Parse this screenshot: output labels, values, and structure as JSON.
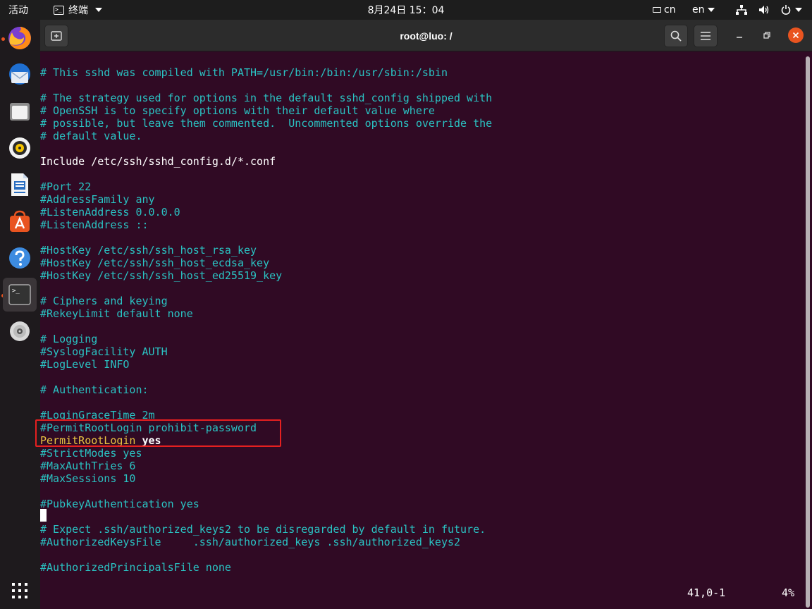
{
  "topbar": {
    "activities": "活动",
    "app_name": "终端",
    "clock": "8月24日 15：04",
    "input_method": "cn",
    "language": "en"
  },
  "window": {
    "title": "root@luo: /"
  },
  "terminal": {
    "lines": [
      "# This sshd was compiled with PATH=/usr/bin:/bin:/usr/sbin:/sbin",
      "# The strategy used for options in the default sshd_config shipped with",
      "# OpenSSH is to specify options with their default value where",
      "# possible, but leave them commented.  Uncommented options override the",
      "# default value.",
      "Include /etc/ssh/sshd_config.d/*.conf",
      "#Port 22",
      "#AddressFamily any",
      "#ListenAddress 0.0.0.0",
      "#ListenAddress ::",
      "#HostKey /etc/ssh/ssh_host_rsa_key",
      "#HostKey /etc/ssh/ssh_host_ecdsa_key",
      "#HostKey /etc/ssh/ssh_host_ed25519_key",
      "# Ciphers and keying",
      "#RekeyLimit default none",
      "# Logging",
      "#SyslogFacility AUTH",
      "#LogLevel INFO",
      "# Authentication:",
      "#LoginGraceTime 2m",
      "#PermitRootLogin prohibit-password",
      "#StrictModes yes",
      "#MaxAuthTries 6",
      "#MaxSessions 10",
      "#PubkeyAuthentication yes",
      "# Expect .ssh/authorized_keys2 to be disregarded by default in future.",
      "#AuthorizedKeysFile     .ssh/authorized_keys .ssh/authorized_keys2",
      "#AuthorizedPrincipalsFile none"
    ],
    "active_line": {
      "keyword": "PermitRootLogin",
      "value": "yes"
    },
    "status": {
      "position": "41,0-1",
      "percent": "4%"
    }
  },
  "colors": {
    "terminal_bg": "#300a24",
    "comment_text": "#2ac3c3",
    "keyword_yellow": "#e8c342",
    "highlight_box": "#e52020",
    "accent": "#e95420"
  },
  "dock": {
    "items": [
      "firefox-icon",
      "thunderbird-icon",
      "files-icon",
      "rhythmbox-icon",
      "libreoffice-writer-icon",
      "ubuntu-software-icon",
      "help-icon",
      "terminal-icon",
      "dvd-icon",
      "show-apps-icon"
    ]
  }
}
